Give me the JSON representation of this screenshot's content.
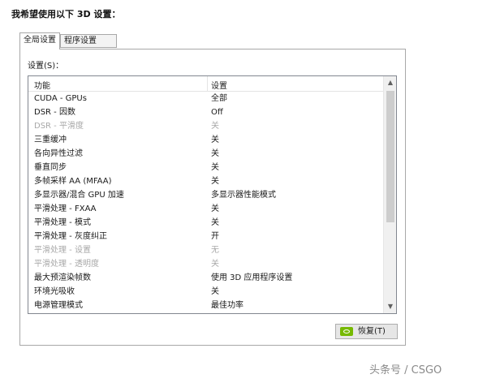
{
  "page": {
    "heading": "我希望使用以下 3D 设置："
  },
  "tabs": [
    {
      "label": "全局设置",
      "active": true
    },
    {
      "label": "程序设置",
      "active": false
    }
  ],
  "settings": {
    "label": "设置(S)：",
    "columns": {
      "feature": "功能",
      "setting": "设置"
    },
    "rows": [
      {
        "name": "CUDA - GPUs",
        "value": "全部",
        "disabled": false
      },
      {
        "name": "DSR - 因数",
        "value": "Off",
        "disabled": false
      },
      {
        "name": "DSR - 平滑度",
        "value": "关",
        "disabled": true
      },
      {
        "name": "三重缓冲",
        "value": "关",
        "disabled": false
      },
      {
        "name": "各向异性过滤",
        "value": "关",
        "disabled": false
      },
      {
        "name": "垂直同步",
        "value": "关",
        "disabled": false
      },
      {
        "name": "多帧采样 AA (MFAA)",
        "value": "关",
        "disabled": false
      },
      {
        "name": "多显示器/混合 GPU 加速",
        "value": "多显示器性能模式",
        "disabled": false
      },
      {
        "name": "平滑处理 - FXAA",
        "value": "关",
        "disabled": false
      },
      {
        "name": "平滑处理 - 模式",
        "value": "关",
        "disabled": false
      },
      {
        "name": "平滑处理 - 灰度纠正",
        "value": "开",
        "disabled": false
      },
      {
        "name": "平滑处理 - 设置",
        "value": "无",
        "disabled": true
      },
      {
        "name": "平滑处理 - 透明度",
        "value": "关",
        "disabled": true
      },
      {
        "name": "最大预渲染帧数",
        "value": "使用 3D 应用程序设置",
        "disabled": false
      },
      {
        "name": "环境光吸收",
        "value": "关",
        "disabled": false
      },
      {
        "name": "电源管理模式",
        "value": "最佳功率",
        "disabled": false
      }
    ]
  },
  "restore_button": {
    "label": "恢复(T)",
    "icon": "nvidia-icon"
  },
  "watermark": "头条号 / CSGO",
  "colors": {
    "nvidia_green": "#76b900",
    "disabled_text": "#a8a8a8"
  }
}
